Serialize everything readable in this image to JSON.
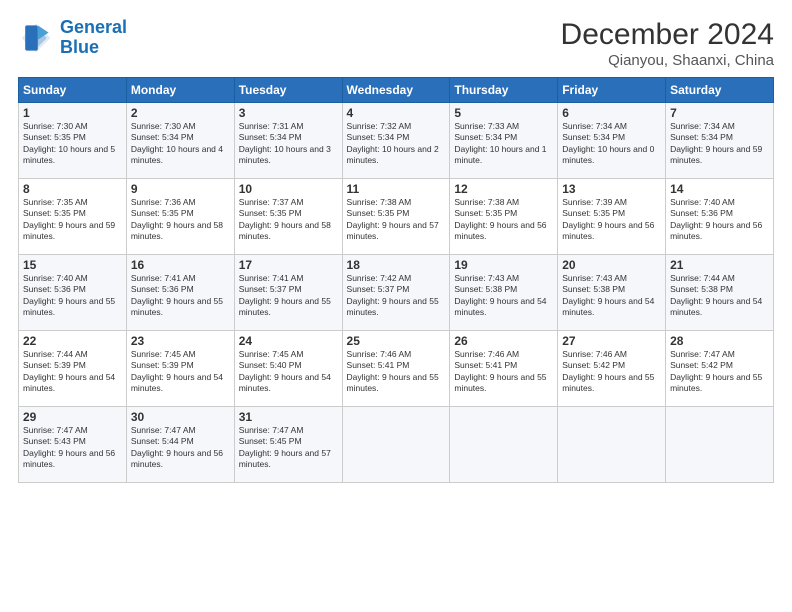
{
  "logo": {
    "line1": "General",
    "line2": "Blue"
  },
  "title": "December 2024",
  "subtitle": "Qianyou, Shaanxi, China",
  "days_of_week": [
    "Sunday",
    "Monday",
    "Tuesday",
    "Wednesday",
    "Thursday",
    "Friday",
    "Saturday"
  ],
  "weeks": [
    [
      {
        "day": 1,
        "sunrise": "7:30 AM",
        "sunset": "5:35 PM",
        "daylight": "10 hours and 5 minutes."
      },
      {
        "day": 2,
        "sunrise": "7:30 AM",
        "sunset": "5:34 PM",
        "daylight": "10 hours and 4 minutes."
      },
      {
        "day": 3,
        "sunrise": "7:31 AM",
        "sunset": "5:34 PM",
        "daylight": "10 hours and 3 minutes."
      },
      {
        "day": 4,
        "sunrise": "7:32 AM",
        "sunset": "5:34 PM",
        "daylight": "10 hours and 2 minutes."
      },
      {
        "day": 5,
        "sunrise": "7:33 AM",
        "sunset": "5:34 PM",
        "daylight": "10 hours and 1 minute."
      },
      {
        "day": 6,
        "sunrise": "7:34 AM",
        "sunset": "5:34 PM",
        "daylight": "10 hours and 0 minutes."
      },
      {
        "day": 7,
        "sunrise": "7:34 AM",
        "sunset": "5:34 PM",
        "daylight": "9 hours and 59 minutes."
      }
    ],
    [
      {
        "day": 8,
        "sunrise": "7:35 AM",
        "sunset": "5:35 PM",
        "daylight": "9 hours and 59 minutes."
      },
      {
        "day": 9,
        "sunrise": "7:36 AM",
        "sunset": "5:35 PM",
        "daylight": "9 hours and 58 minutes."
      },
      {
        "day": 10,
        "sunrise": "7:37 AM",
        "sunset": "5:35 PM",
        "daylight": "9 hours and 58 minutes."
      },
      {
        "day": 11,
        "sunrise": "7:38 AM",
        "sunset": "5:35 PM",
        "daylight": "9 hours and 57 minutes."
      },
      {
        "day": 12,
        "sunrise": "7:38 AM",
        "sunset": "5:35 PM",
        "daylight": "9 hours and 56 minutes."
      },
      {
        "day": 13,
        "sunrise": "7:39 AM",
        "sunset": "5:35 PM",
        "daylight": "9 hours and 56 minutes."
      },
      {
        "day": 14,
        "sunrise": "7:40 AM",
        "sunset": "5:36 PM",
        "daylight": "9 hours and 56 minutes."
      }
    ],
    [
      {
        "day": 15,
        "sunrise": "7:40 AM",
        "sunset": "5:36 PM",
        "daylight": "9 hours and 55 minutes."
      },
      {
        "day": 16,
        "sunrise": "7:41 AM",
        "sunset": "5:36 PM",
        "daylight": "9 hours and 55 minutes."
      },
      {
        "day": 17,
        "sunrise": "7:41 AM",
        "sunset": "5:37 PM",
        "daylight": "9 hours and 55 minutes."
      },
      {
        "day": 18,
        "sunrise": "7:42 AM",
        "sunset": "5:37 PM",
        "daylight": "9 hours and 55 minutes."
      },
      {
        "day": 19,
        "sunrise": "7:43 AM",
        "sunset": "5:38 PM",
        "daylight": "9 hours and 54 minutes."
      },
      {
        "day": 20,
        "sunrise": "7:43 AM",
        "sunset": "5:38 PM",
        "daylight": "9 hours and 54 minutes."
      },
      {
        "day": 21,
        "sunrise": "7:44 AM",
        "sunset": "5:38 PM",
        "daylight": "9 hours and 54 minutes."
      }
    ],
    [
      {
        "day": 22,
        "sunrise": "7:44 AM",
        "sunset": "5:39 PM",
        "daylight": "9 hours and 54 minutes."
      },
      {
        "day": 23,
        "sunrise": "7:45 AM",
        "sunset": "5:39 PM",
        "daylight": "9 hours and 54 minutes."
      },
      {
        "day": 24,
        "sunrise": "7:45 AM",
        "sunset": "5:40 PM",
        "daylight": "9 hours and 54 minutes."
      },
      {
        "day": 25,
        "sunrise": "7:46 AM",
        "sunset": "5:41 PM",
        "daylight": "9 hours and 55 minutes."
      },
      {
        "day": 26,
        "sunrise": "7:46 AM",
        "sunset": "5:41 PM",
        "daylight": "9 hours and 55 minutes."
      },
      {
        "day": 27,
        "sunrise": "7:46 AM",
        "sunset": "5:42 PM",
        "daylight": "9 hours and 55 minutes."
      },
      {
        "day": 28,
        "sunrise": "7:47 AM",
        "sunset": "5:42 PM",
        "daylight": "9 hours and 55 minutes."
      }
    ],
    [
      {
        "day": 29,
        "sunrise": "7:47 AM",
        "sunset": "5:43 PM",
        "daylight": "9 hours and 56 minutes."
      },
      {
        "day": 30,
        "sunrise": "7:47 AM",
        "sunset": "5:44 PM",
        "daylight": "9 hours and 56 minutes."
      },
      {
        "day": 31,
        "sunrise": "7:47 AM",
        "sunset": "5:45 PM",
        "daylight": "9 hours and 57 minutes."
      },
      null,
      null,
      null,
      null
    ]
  ]
}
